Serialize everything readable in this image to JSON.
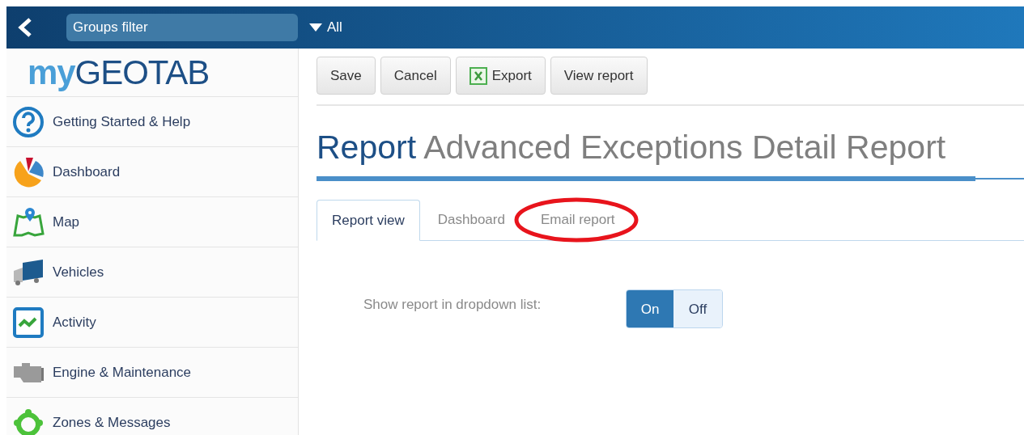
{
  "header": {
    "filter_label": "Groups filter",
    "filter_value": "All"
  },
  "logo": {
    "part_1": "my",
    "part_2": "GEOTAB"
  },
  "sidebar": {
    "items": [
      {
        "label": "Getting Started & Help",
        "kind": "help"
      },
      {
        "label": "Dashboard",
        "kind": "pie"
      },
      {
        "label": "Map",
        "kind": "map"
      },
      {
        "label": "Vehicles",
        "kind": "truck"
      },
      {
        "label": "Activity",
        "kind": "activity"
      },
      {
        "label": "Engine & Maintenance",
        "kind": "engine"
      },
      {
        "label": "Zones & Messages",
        "kind": "zones"
      }
    ]
  },
  "toolbar": {
    "buttons": [
      {
        "label": "Save",
        "kind": "plain"
      },
      {
        "label": "Cancel",
        "kind": "plain"
      },
      {
        "label": "Export",
        "kind": "excel"
      },
      {
        "label": "View report",
        "kind": "plain"
      }
    ]
  },
  "title": {
    "prefix": "Report",
    "name": "Advanced Exceptions Detail Report"
  },
  "tabs": [
    {
      "label": "Report view",
      "selected": true,
      "circled": false
    },
    {
      "label": "Dashboard",
      "selected": false,
      "circled": false
    },
    {
      "label": "Email report",
      "selected": false,
      "circled": true
    }
  ],
  "setting": {
    "label": "Show report in dropdown list:",
    "options": [
      {
        "label": "On",
        "selected": true
      },
      {
        "label": "Off",
        "selected": false
      }
    ]
  }
}
